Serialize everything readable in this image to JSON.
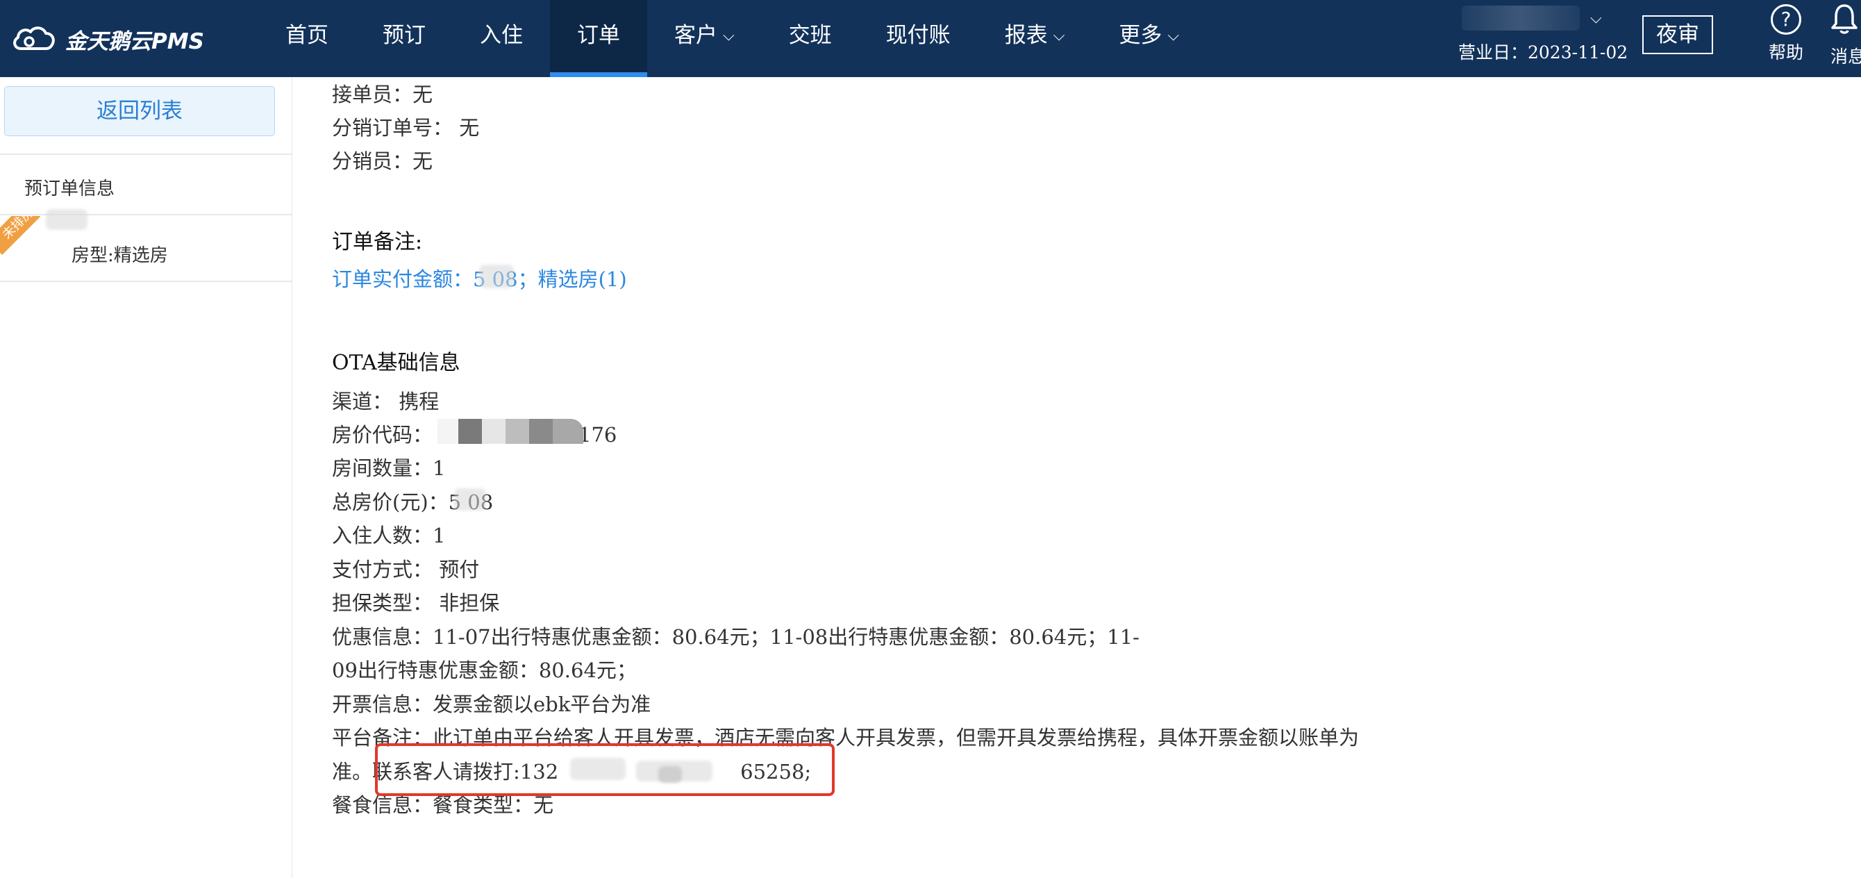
{
  "header": {
    "logo_text": "金天鹅云PMS",
    "nav": [
      {
        "label": "首页",
        "dropdown": false,
        "active": false
      },
      {
        "label": "预订",
        "dropdown": false,
        "active": false
      },
      {
        "label": "入住",
        "dropdown": false,
        "active": false
      },
      {
        "label": "订单",
        "dropdown": false,
        "active": true
      },
      {
        "label": "客户",
        "dropdown": true,
        "active": false
      },
      {
        "label": "交班",
        "dropdown": false,
        "active": false
      },
      {
        "label": "现付账",
        "dropdown": false,
        "active": false
      },
      {
        "label": "报表",
        "dropdown": true,
        "active": false
      },
      {
        "label": "更多",
        "dropdown": true,
        "active": false
      }
    ],
    "business_date": "营业日：2023-11-02",
    "night_audit_label": "夜审",
    "help_label": "帮助",
    "message_label": "消息"
  },
  "sidebar": {
    "back_label": "返回列表",
    "reservation_info_label": "预订单信息",
    "ribbon_text": "未排房",
    "room_type_label": "房型:精选房"
  },
  "main": {
    "order_taker": "接单员：无",
    "distribution_order_no": "分销订单号：  无",
    "distributor": "分销员：无",
    "order_remark_title": "订单备注:",
    "order_paid_amount": "订单实付金额：5  08；精选房(1)",
    "ota_title": "OTA基础信息",
    "channel": "渠道：  携程",
    "rate_code_prefix": "房价代码：",
    "rate_code_suffix": "176",
    "room_count": "房间数量：1",
    "total_price": "总房价(元)：5  08",
    "guest_count": "入住人数：1",
    "payment_method": "支付方式：  预付",
    "guarantee_type": "担保类型：  非担保",
    "discount_line1": "优惠信息：11-07出行特惠优惠金额：80.64元；11-08出行特惠优惠金额：80.64元；11-",
    "discount_line2": "09出行特惠优惠金额：80.64元；",
    "invoice_info": "开票信息：发票金额以ebk平台为准",
    "platform_remark_line1": "平台备注：此订单由平台给客人开具发票，酒店无需向客人开具发票，但需开具发票给携程，具体开票金额以账单为",
    "platform_remark_line2_prefix": "准。",
    "contact_prefix": "联系客人请拨打:132",
    "contact_suffix": "65258;",
    "meal_info": "餐食信息：餐食类型：无"
  },
  "colors": {
    "topbar_bg": "#12325a",
    "active_tab_underline": "#2f8cf0",
    "link_blue": "#2b87e0",
    "highlight_red": "#e0392b",
    "ribbon_orange": "#f0a042"
  }
}
